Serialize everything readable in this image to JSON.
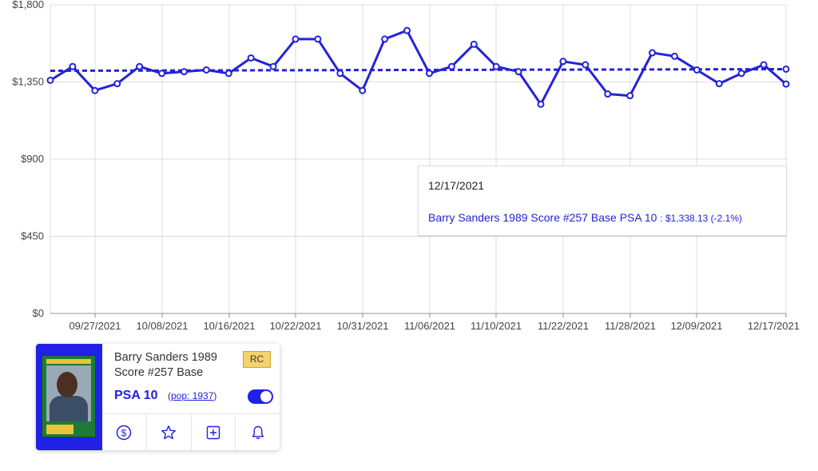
{
  "chart_data": {
    "type": "line",
    "yticks": [
      "$0",
      "$450",
      "$900",
      "$1,350",
      "$1,800"
    ],
    "ylim": [
      0,
      1800
    ],
    "xticks": [
      "09/27/2021",
      "10/08/2021",
      "10/16/2021",
      "10/22/2021",
      "10/31/2021",
      "11/06/2021",
      "11/10/2021",
      "11/22/2021",
      "11/28/2021",
      "12/09/2021",
      "12/17/2021"
    ],
    "grid": true,
    "series": [
      {
        "name": "Barry Sanders 1989 Score #257 Base PSA 10",
        "values": [
          1360,
          1440,
          1300,
          1340,
          1440,
          1400,
          1410,
          1420,
          1400,
          1490,
          1440,
          1600,
          1600,
          1400,
          1300,
          1600,
          1650,
          1400,
          1440,
          1570,
          1440,
          1410,
          1220,
          1470,
          1450,
          1280,
          1270,
          1520,
          1500,
          1420,
          1340,
          1400,
          1450,
          1338
        ]
      }
    ],
    "average": 1420,
    "color": "#2323d8"
  },
  "tooltip": {
    "date": "12/17/2021",
    "series_label": "Barry Sanders 1989 Score #257 Base PSA 10",
    "value_text": ": $1,338.13 (-2.1%)"
  },
  "card": {
    "title": "Barry Sanders 1989 Score #257 Base",
    "badge": "RC",
    "grade": "PSA 10",
    "pop_prefix": "(",
    "pop_link": "pop: 1937",
    "pop_suffix": ")",
    "toggle_on": true,
    "actions": [
      {
        "icon": "dollar-icon"
      },
      {
        "icon": "star-icon"
      },
      {
        "icon": "add-box-icon"
      },
      {
        "icon": "bell-icon"
      }
    ]
  }
}
